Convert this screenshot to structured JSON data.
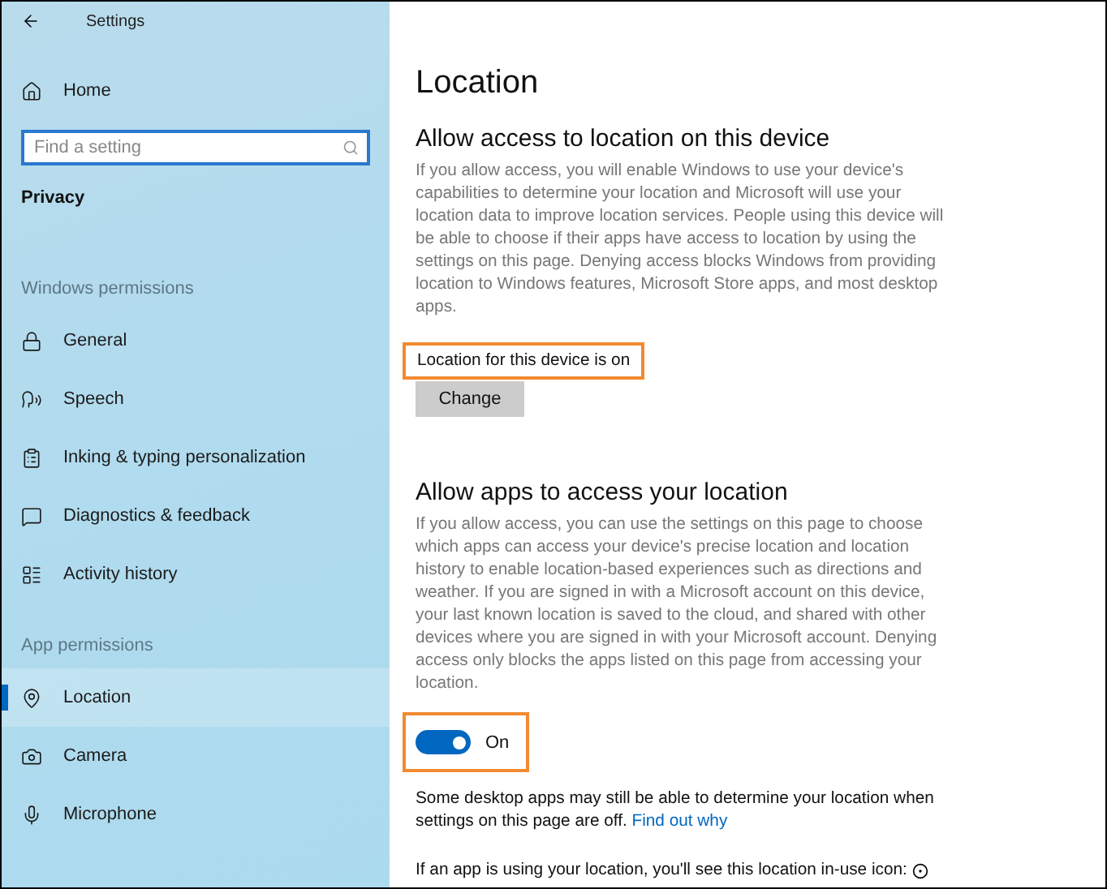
{
  "window": {
    "title": "Settings"
  },
  "sidebar": {
    "home": "Home",
    "search": {
      "placeholder": "Find a setting"
    },
    "section_title": "Privacy",
    "groups": [
      {
        "heading": "Windows permissions",
        "items": [
          {
            "label": "General",
            "selected": false
          },
          {
            "label": "Speech",
            "selected": false
          },
          {
            "label": "Inking & typing personalization",
            "selected": false
          },
          {
            "label": "Diagnostics & feedback",
            "selected": false
          },
          {
            "label": "Activity history",
            "selected": false
          }
        ]
      },
      {
        "heading": "App permissions",
        "items": [
          {
            "label": "Location",
            "selected": true
          },
          {
            "label": "Camera",
            "selected": false
          },
          {
            "label": "Microphone",
            "selected": false
          }
        ]
      }
    ]
  },
  "content": {
    "title": "Location",
    "device_section": {
      "heading": "Allow access to location on this device",
      "description": "If you allow access, you will enable Windows to use your device's capabilities to determine your location and Microsoft will use your location data to improve location services. People using this device will be able to choose if their apps have access to location by using the settings on this page. Denying access blocks Windows from providing location to Windows features, Microsoft Store apps, and most desktop apps.",
      "status": "Location for this device is on",
      "status_highlighted": true,
      "button": "Change"
    },
    "apps_section": {
      "heading": "Allow apps to access your location",
      "description": "If you allow access, you can use the settings on this page to choose which apps can access your device's precise location and location history to enable location-based experiences such as directions and weather. If you are signed in with a Microsoft account on this device, your last known location is saved to the cloud, and shared with other devices where you are signed in with your Microsoft account. Denying access only blocks the apps listed on this page from accessing your location.",
      "toggle": {
        "on": true,
        "label": "On",
        "highlighted": true
      },
      "note": "Some desktop apps may still be able to determine your location when settings on this page are off.",
      "link": "Find out why",
      "in_use_text": "If an app is using your location, you'll see this location in-use icon:"
    }
  }
}
